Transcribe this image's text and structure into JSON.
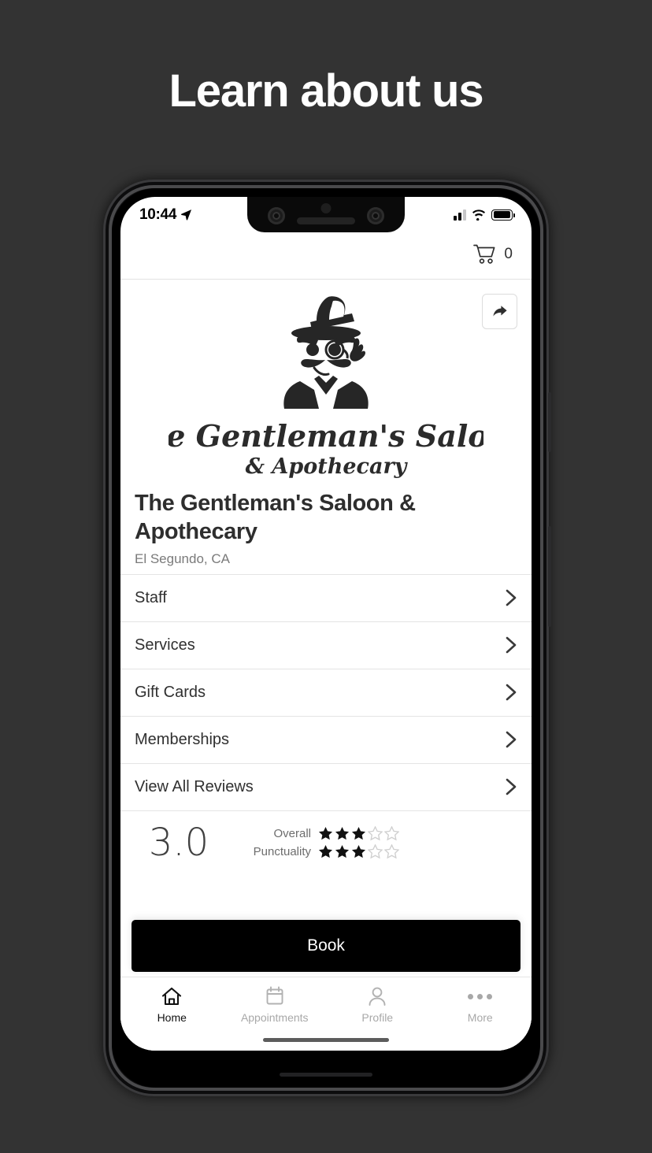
{
  "headline": "Learn about us",
  "theme": {
    "page_background": "#333333",
    "headline_color": "#ffffff",
    "accent_button": "#000000",
    "screen_background": "#ffffff",
    "muted_text": "#7a7a7a"
  },
  "status_bar": {
    "time": "10:44",
    "location_icon": "location-arrow-icon",
    "signal_icon": "cellular-signal-icon",
    "wifi_icon": "wifi-icon",
    "battery_icon": "battery-full-icon"
  },
  "topbar": {
    "cart_icon": "shopping-cart-icon",
    "cart_count": "0"
  },
  "share": {
    "icon": "share-arrow-icon"
  },
  "business": {
    "logo_title_line1": "The Gentleman's Saloon",
    "logo_title_line2": "& Apothecary",
    "name": "The Gentleman's Saloon & Apothecary",
    "location": "El Segundo, CA"
  },
  "menu": {
    "items": [
      {
        "label": "Staff",
        "chevron": "chevron-right-icon"
      },
      {
        "label": "Services",
        "chevron": "chevron-right-icon"
      },
      {
        "label": "Gift Cards",
        "chevron": "chevron-right-icon"
      },
      {
        "label": "Memberships",
        "chevron": "chevron-right-icon"
      },
      {
        "label": "View All Reviews",
        "chevron": "chevron-right-icon"
      }
    ]
  },
  "ratings": {
    "score": "3.0",
    "max_stars": 5,
    "rows": [
      {
        "label": "Overall",
        "filled": 3
      },
      {
        "label": "Punctuality",
        "filled": 3
      }
    ]
  },
  "primary_action": {
    "label": "Book"
  },
  "tabbar": {
    "items": [
      {
        "label": "Home",
        "icon": "home-icon",
        "active": true
      },
      {
        "label": "Appointments",
        "icon": "calendar-icon",
        "active": false
      },
      {
        "label": "Profile",
        "icon": "person-icon",
        "active": false
      },
      {
        "label": "More",
        "icon": "ellipsis-icon",
        "active": false
      }
    ]
  }
}
